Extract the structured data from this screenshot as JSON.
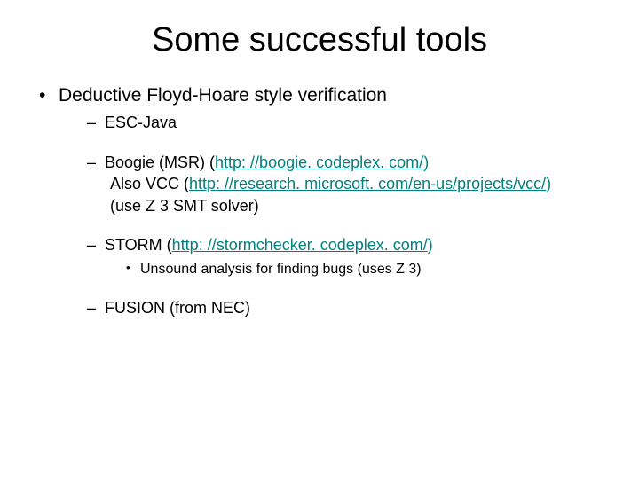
{
  "title": "Some successful tools",
  "bullet1": "Deductive Floyd-Hoare style verification",
  "sub1": "ESC-Java",
  "sub2_prefix": "Boogie (MSR)   (",
  "sub2_link": "http: //boogie. codeplex. com/",
  "sub2_suffix": ")",
  "sub2_line2_prefix": " Also VCC (",
  "sub2_line2_link": "http: //research. microsoft. com/en-us/projects/vcc/",
  "sub2_line2_suffix": ")",
  "sub2_line3": " (use Z 3 SMT solver)",
  "sub3_prefix": "STORM (",
  "sub3_link": "http: //stormchecker. codeplex. com/",
  "sub3_suffix": ")",
  "sub3_sub": "Unsound analysis for finding bugs (uses Z 3)",
  "sub4": "FUSION (from NEC)"
}
